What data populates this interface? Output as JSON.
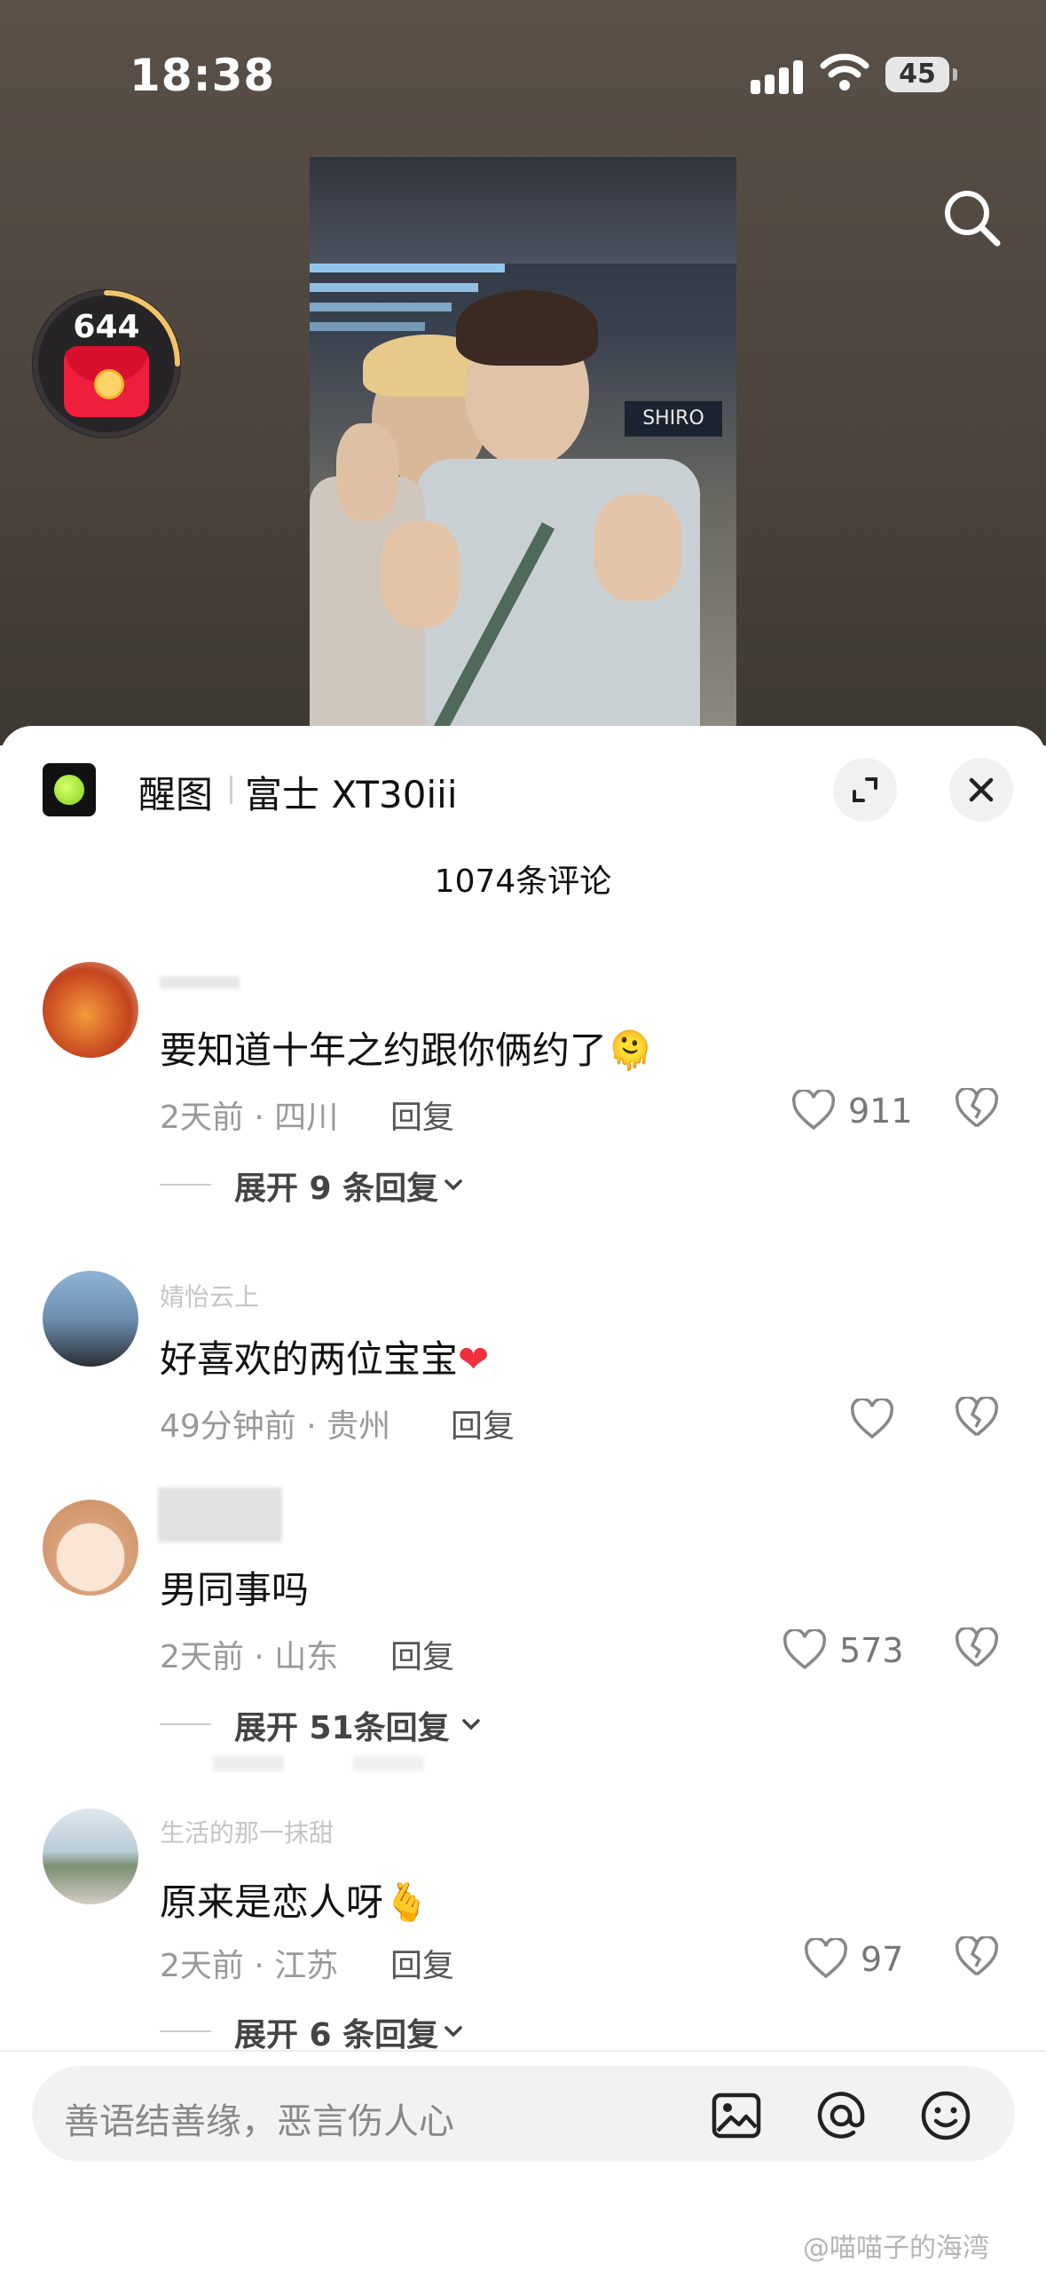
{
  "status_bar": {
    "time": "18:38",
    "battery": "45"
  },
  "red_packet": {
    "count": "644"
  },
  "photo_sign": "SHIRO",
  "sheet": {
    "app_name": "醒图",
    "camera": "富士 XT30iii",
    "comment_count": "1074条评论"
  },
  "comments": [
    {
      "username": "",
      "text": "要知道十年之约跟你俩约了",
      "emoji": "🫠",
      "meta": "2天前 · 四川",
      "reply": "回复",
      "likes": "911",
      "expand": "展开 9 条回复"
    },
    {
      "username": "婧怡云上",
      "text": "好喜欢的两位宝宝",
      "emoji": "❤",
      "meta": "49分钟前 · 贵州",
      "reply": "回复",
      "likes": "",
      "expand": ""
    },
    {
      "username": "",
      "text": "男同事吗",
      "emoji": "",
      "meta": "2天前 · 山东",
      "reply": "回复",
      "likes": "573",
      "expand": "展开 51条回复"
    },
    {
      "username": "生活的那一抹甜",
      "text": "原来是恋人呀",
      "emoji": "🫰",
      "meta": "2天前 · 江苏",
      "reply": "回复",
      "likes": "97",
      "expand": "展开 6 条回复"
    }
  ],
  "input": {
    "placeholder": "善语结善缘，恶言伤人心"
  },
  "watermark": "@喵喵子的海湾",
  "colors": {
    "heart_red": "#f0303e",
    "text_primary": "#111111",
    "text_secondary": "#999999"
  }
}
